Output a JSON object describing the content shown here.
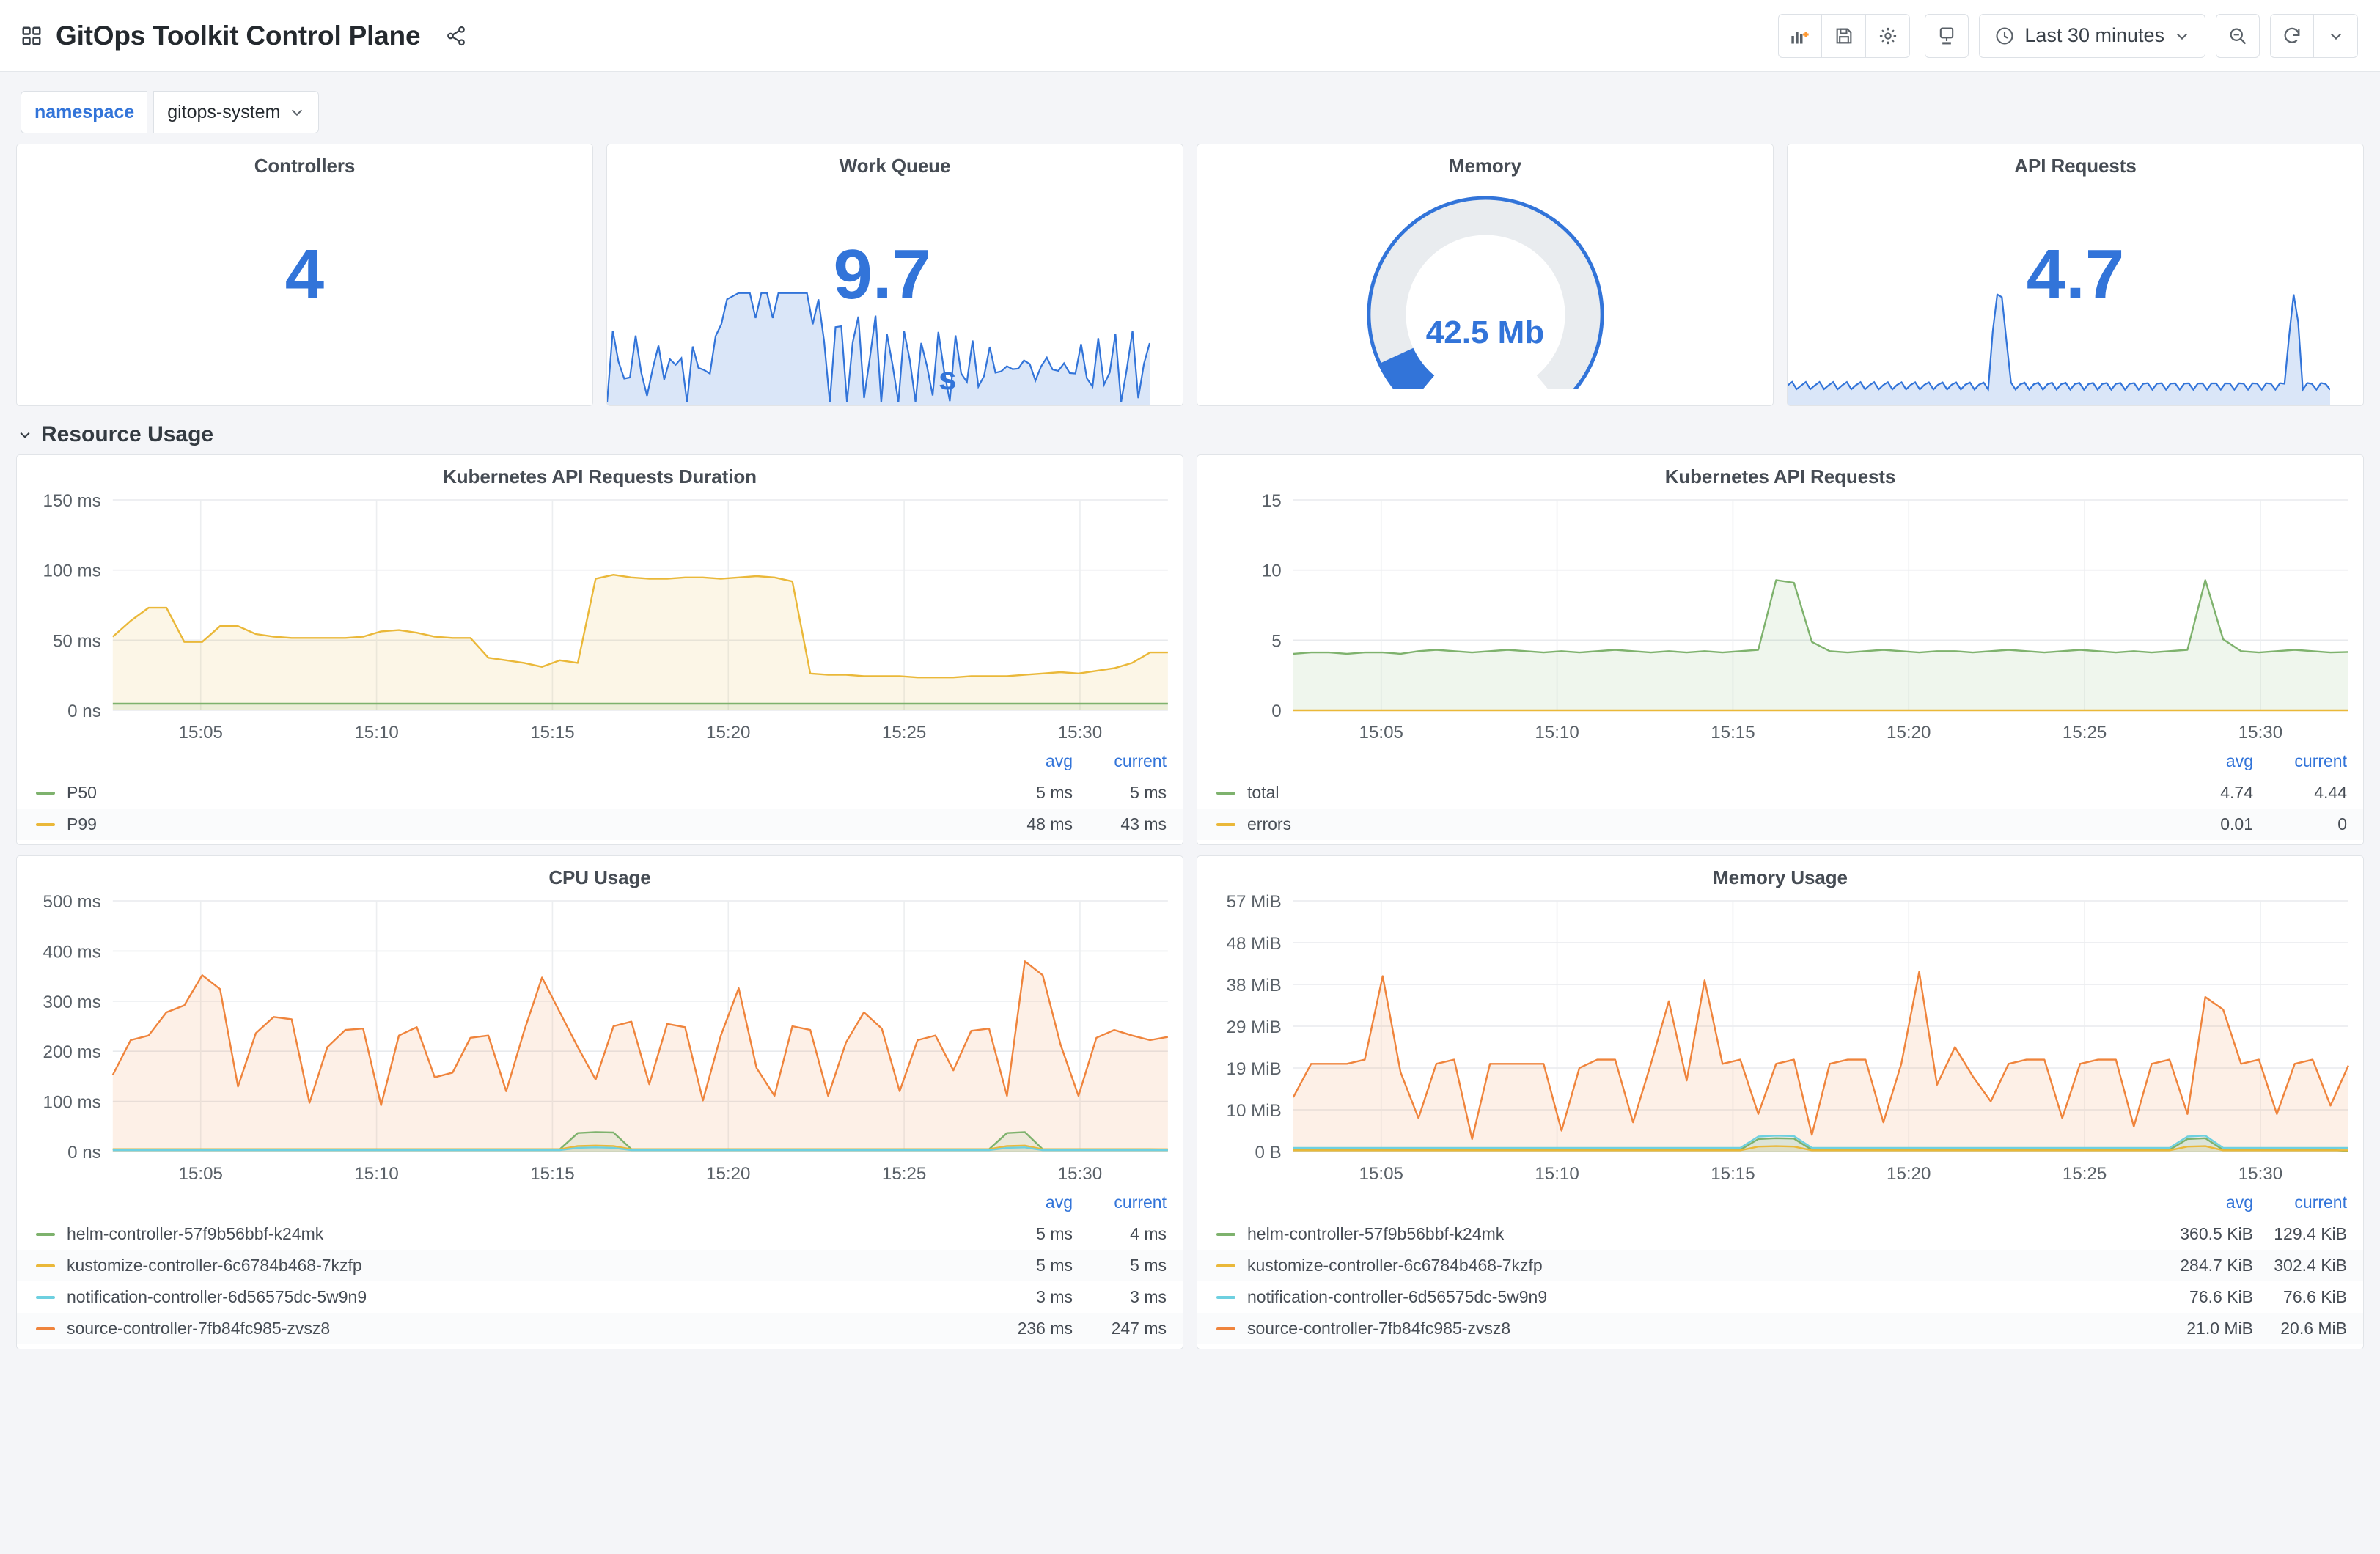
{
  "header": {
    "title": "GitOps Toolkit Control Plane",
    "grid_icon": "grid-icon",
    "share_icon": "share-icon",
    "toolbar": {
      "add_panel_label": "add-panel",
      "save_label": "save-dashboard",
      "settings_label": "dashboard-settings",
      "tv_label": "tv-mode",
      "time_range": "Last 30 minutes",
      "zoom_out_label": "zoom-out",
      "refresh_label": "refresh",
      "refresh_interval_label": "refresh-interval"
    }
  },
  "variables": [
    {
      "label": "namespace",
      "value": "gitops-system"
    }
  ],
  "section": {
    "title": "Resource Usage",
    "collapsed": false
  },
  "stats": [
    {
      "title": "Controllers",
      "value": "4",
      "unit": "",
      "color": "#3274d9",
      "sparkline": false
    },
    {
      "title": "Work Queue",
      "value": "9.7",
      "unit": "s",
      "color": "#3274d9",
      "sparkline": true
    },
    {
      "title": "Memory",
      "value": "42.5 Mb",
      "unit": "",
      "color": "#3274d9",
      "gauge": true,
      "gauge_pct": 9
    },
    {
      "title": "API Requests",
      "value": "4.7",
      "unit": "",
      "color": "#3274d9",
      "sparkline": true
    }
  ],
  "chart_data": [
    {
      "type": "area",
      "title": "Kubernetes API Requests Duration",
      "xlabel": "",
      "ylabel": "",
      "ylim": [
        0,
        160
      ],
      "yticks": [
        "0 ns",
        "50 ms",
        "100 ms",
        "150 ms"
      ],
      "xticks": [
        "15:05",
        "15:10",
        "15:15",
        "15:20",
        "15:25",
        "15:30"
      ],
      "grid": true,
      "legend_position": "bottom-table",
      "legend_columns": [
        "avg",
        "current"
      ],
      "series": [
        {
          "name": "P50",
          "color": "#7eb26d",
          "avg": "5 ms",
          "current": "5 ms",
          "values": [
            5,
            5,
            5,
            5,
            5,
            5,
            5,
            5,
            5,
            5,
            5,
            5,
            5,
            5,
            5,
            5,
            5,
            5,
            5,
            5,
            5,
            5,
            5,
            5,
            5,
            5,
            5,
            5,
            5,
            5,
            5,
            5,
            5,
            5,
            5,
            5,
            5,
            5,
            5,
            5,
            5,
            5,
            5,
            5,
            5,
            5,
            5,
            5,
            5,
            5,
            5,
            5,
            5,
            5,
            5,
            5,
            5,
            5,
            5,
            5
          ]
        },
        {
          "name": "P99",
          "color": "#eab839",
          "avg": "48 ms",
          "current": "43 ms",
          "values": [
            56,
            68,
            78,
            78,
            52,
            52,
            64,
            64,
            58,
            56,
            55,
            55,
            55,
            55,
            56,
            60,
            61,
            59,
            56,
            55,
            55,
            40,
            38,
            36,
            33,
            38,
            36,
            100,
            103,
            101,
            100,
            100,
            101,
            101,
            100,
            101,
            102,
            101,
            98,
            28,
            27,
            27,
            26,
            26,
            26,
            25,
            25,
            25,
            26,
            26,
            26,
            27,
            28,
            29,
            28,
            30,
            32,
            36,
            44,
            44
          ]
        }
      ]
    },
    {
      "type": "area",
      "title": "Kubernetes API Requests",
      "xlabel": "",
      "ylabel": "",
      "ylim": [
        0,
        16
      ],
      "yticks": [
        "0",
        "5",
        "10",
        "15"
      ],
      "xticks": [
        "15:05",
        "15:10",
        "15:15",
        "15:20",
        "15:25",
        "15:30"
      ],
      "grid": true,
      "legend_position": "bottom-table",
      "legend_columns": [
        "avg",
        "current"
      ],
      "series": [
        {
          "name": "total",
          "color": "#7eb26d",
          "avg": "4.74",
          "current": "4.44",
          "values": [
            4.3,
            4.4,
            4.4,
            4.3,
            4.4,
            4.4,
            4.3,
            4.5,
            4.6,
            4.5,
            4.4,
            4.5,
            4.6,
            4.5,
            4.4,
            4.5,
            4.4,
            4.5,
            4.6,
            4.5,
            4.4,
            4.5,
            4.4,
            4.5,
            4.4,
            4.5,
            4.6,
            9.9,
            9.7,
            5.2,
            4.5,
            4.4,
            4.5,
            4.6,
            4.5,
            4.4,
            4.5,
            4.5,
            4.4,
            4.5,
            4.6,
            4.5,
            4.4,
            4.5,
            4.6,
            4.5,
            4.4,
            4.5,
            4.4,
            4.5,
            4.6,
            9.9,
            5.4,
            4.5,
            4.4,
            4.5,
            4.6,
            4.5,
            4.4,
            4.44
          ]
        },
        {
          "name": "errors",
          "color": "#eab839",
          "avg": "0.01",
          "current": "0",
          "values": [
            0,
            0,
            0,
            0,
            0,
            0,
            0,
            0,
            0,
            0,
            0,
            0,
            0,
            0,
            0,
            0,
            0,
            0,
            0,
            0,
            0,
            0,
            0,
            0,
            0,
            0,
            0,
            0,
            0,
            0,
            0,
            0,
            0,
            0,
            0,
            0,
            0,
            0,
            0,
            0,
            0,
            0,
            0,
            0,
            0,
            0,
            0,
            0,
            0,
            0,
            0,
            0,
            0,
            0,
            0,
            0,
            0,
            0,
            0,
            0
          ]
        }
      ]
    },
    {
      "type": "area",
      "title": "CPU Usage",
      "xlabel": "",
      "ylabel": "",
      "ylim": [
        0,
        540
      ],
      "yticks": [
        "0 ns",
        "100 ms",
        "200 ms",
        "300 ms",
        "400 ms",
        "500 ms"
      ],
      "xticks": [
        "15:05",
        "15:10",
        "15:15",
        "15:20",
        "15:25",
        "15:30"
      ],
      "grid": true,
      "legend_position": "bottom-table",
      "legend_columns": [
        "avg",
        "current"
      ],
      "series": [
        {
          "name": "helm-controller-57f9b56bbf-k24mk",
          "color": "#7eb26d",
          "avg": "5 ms",
          "current": "4 ms",
          "values": [
            5,
            5,
            5,
            5,
            5,
            5,
            5,
            5,
            5,
            5,
            5,
            5,
            5,
            5,
            5,
            5,
            5,
            5,
            5,
            5,
            5,
            5,
            5,
            5,
            5,
            5,
            40,
            42,
            41,
            5,
            5,
            5,
            5,
            5,
            5,
            5,
            5,
            5,
            5,
            5,
            5,
            5,
            5,
            5,
            5,
            5,
            5,
            5,
            5,
            5,
            40,
            42,
            5,
            5,
            5,
            5,
            5,
            5,
            5,
            4
          ]
        },
        {
          "name": "kustomize-controller-6c6784b468-7kzfp",
          "color": "#eab839",
          "avg": "5 ms",
          "current": "5 ms",
          "values": [
            5,
            5,
            5,
            5,
            5,
            5,
            5,
            5,
            5,
            5,
            5,
            5,
            5,
            5,
            5,
            5,
            5,
            5,
            5,
            5,
            5,
            5,
            5,
            5,
            5,
            5,
            12,
            13,
            12,
            5,
            5,
            5,
            5,
            5,
            5,
            5,
            5,
            5,
            5,
            5,
            5,
            5,
            5,
            5,
            5,
            5,
            5,
            5,
            5,
            5,
            12,
            13,
            5,
            5,
            5,
            5,
            5,
            5,
            5,
            5
          ]
        },
        {
          "name": "notification-controller-6d56575dc-5w9n9",
          "color": "#6ed0e0",
          "avg": "3 ms",
          "current": "3 ms",
          "values": [
            3,
            3,
            3,
            3,
            3,
            3,
            3,
            3,
            3,
            3,
            3,
            3,
            3,
            3,
            3,
            3,
            3,
            3,
            3,
            3,
            3,
            3,
            3,
            3,
            3,
            3,
            8,
            9,
            8,
            3,
            3,
            3,
            3,
            3,
            3,
            3,
            3,
            3,
            3,
            3,
            3,
            3,
            3,
            3,
            3,
            3,
            3,
            3,
            3,
            3,
            8,
            9,
            3,
            3,
            3,
            3,
            3,
            3,
            3,
            3
          ]
        },
        {
          "name": "source-controller-7fb84fc985-zvsz8",
          "color": "#ef843c",
          "avg": "236 ms",
          "current": "247 ms",
          "values": [
            165,
            240,
            250,
            300,
            315,
            380,
            350,
            140,
            255,
            290,
            285,
            105,
            225,
            262,
            265,
            100,
            250,
            268,
            160,
            170,
            245,
            250,
            130,
            260,
            375,
            300,
            225,
            155,
            270,
            280,
            145,
            275,
            268,
            110,
            250,
            352,
            180,
            120,
            270,
            262,
            120,
            235,
            300,
            265,
            130,
            240,
            250,
            175,
            260,
            265,
            120,
            410,
            380,
            230,
            120,
            245,
            262,
            250,
            240,
            247
          ]
        }
      ]
    },
    {
      "type": "area",
      "title": "Memory Usage",
      "xlabel": "",
      "ylabel": "",
      "ylim": [
        0,
        60
      ],
      "yticks": [
        "0 B",
        "10 MiB",
        "19 MiB",
        "29 MiB",
        "38 MiB",
        "48 MiB",
        "57 MiB"
      ],
      "xticks": [
        "15:05",
        "15:10",
        "15:15",
        "15:20",
        "15:25",
        "15:30"
      ],
      "grid": true,
      "legend_position": "bottom-table",
      "legend_columns": [
        "avg",
        "current"
      ],
      "series": [
        {
          "name": "helm-controller-57f9b56bbf-k24mk",
          "color": "#7eb26d",
          "avg": "360.5 KiB",
          "current": "129.4 KiB",
          "values": [
            0.4,
            0.4,
            0.4,
            0.4,
            0.4,
            0.4,
            0.4,
            0.4,
            0.4,
            0.4,
            0.4,
            0.4,
            0.4,
            0.4,
            0.4,
            0.4,
            0.4,
            0.4,
            0.4,
            0.4,
            0.4,
            0.4,
            0.4,
            0.4,
            0.4,
            0.4,
            3.0,
            3.2,
            3.1,
            0.4,
            0.4,
            0.4,
            0.4,
            0.4,
            0.4,
            0.4,
            0.4,
            0.4,
            0.4,
            0.4,
            0.4,
            0.4,
            0.4,
            0.4,
            0.4,
            0.4,
            0.4,
            0.4,
            0.4,
            0.4,
            3.0,
            3.2,
            0.4,
            0.4,
            0.4,
            0.4,
            0.4,
            0.4,
            0.4,
            0.13
          ]
        },
        {
          "name": "kustomize-controller-6c6784b468-7kzfp",
          "color": "#eab839",
          "avg": "284.7 KiB",
          "current": "302.4 KiB",
          "values": [
            0.3,
            0.3,
            0.3,
            0.3,
            0.3,
            0.3,
            0.3,
            0.3,
            0.3,
            0.3,
            0.3,
            0.3,
            0.3,
            0.3,
            0.3,
            0.3,
            0.3,
            0.3,
            0.3,
            0.3,
            0.3,
            0.3,
            0.3,
            0.3,
            0.3,
            0.3,
            1.2,
            1.3,
            1.2,
            0.3,
            0.3,
            0.3,
            0.3,
            0.3,
            0.3,
            0.3,
            0.3,
            0.3,
            0.3,
            0.3,
            0.3,
            0.3,
            0.3,
            0.3,
            0.3,
            0.3,
            0.3,
            0.3,
            0.3,
            0.3,
            1.2,
            1.3,
            0.3,
            0.3,
            0.3,
            0.3,
            0.3,
            0.3,
            0.3,
            0.3
          ]
        },
        {
          "name": "notification-controller-6d56575dc-5w9n9",
          "color": "#6ed0e0",
          "avg": "76.6 KiB",
          "current": "76.6 KiB",
          "values": [
            0.9,
            0.9,
            0.9,
            0.9,
            0.9,
            0.9,
            0.9,
            0.9,
            0.9,
            0.9,
            0.9,
            0.9,
            0.9,
            0.9,
            0.9,
            0.9,
            0.9,
            0.9,
            0.9,
            0.9,
            0.9,
            0.9,
            0.9,
            0.9,
            0.9,
            0.9,
            3.6,
            3.8,
            3.7,
            0.9,
            0.9,
            0.9,
            0.9,
            0.9,
            0.9,
            0.9,
            0.9,
            0.9,
            0.9,
            0.9,
            0.9,
            0.9,
            0.9,
            0.9,
            0.9,
            0.9,
            0.9,
            0.9,
            0.9,
            0.9,
            3.6,
            3.8,
            0.9,
            0.9,
            0.9,
            0.9,
            0.9,
            0.9,
            0.9,
            0.9
          ]
        },
        {
          "name": "source-controller-7fb84fc985-zvsz8",
          "color": "#ef843c",
          "avg": "21.0 MiB",
          "current": "20.6 MiB",
          "values": [
            13,
            21,
            21,
            21,
            22,
            42,
            19,
            8,
            21,
            22,
            3,
            21,
            21,
            21,
            21,
            5,
            20,
            22,
            22,
            7,
            21,
            36,
            17,
            41,
            21,
            22,
            9,
            21,
            22,
            4,
            21,
            22,
            22,
            7,
            21,
            43,
            16,
            25,
            18,
            12,
            21,
            22,
            22,
            8,
            21,
            22,
            22,
            6,
            21,
            22,
            9,
            37,
            34,
            21,
            22,
            9,
            21,
            22,
            11,
            20.6
          ]
        }
      ]
    }
  ]
}
